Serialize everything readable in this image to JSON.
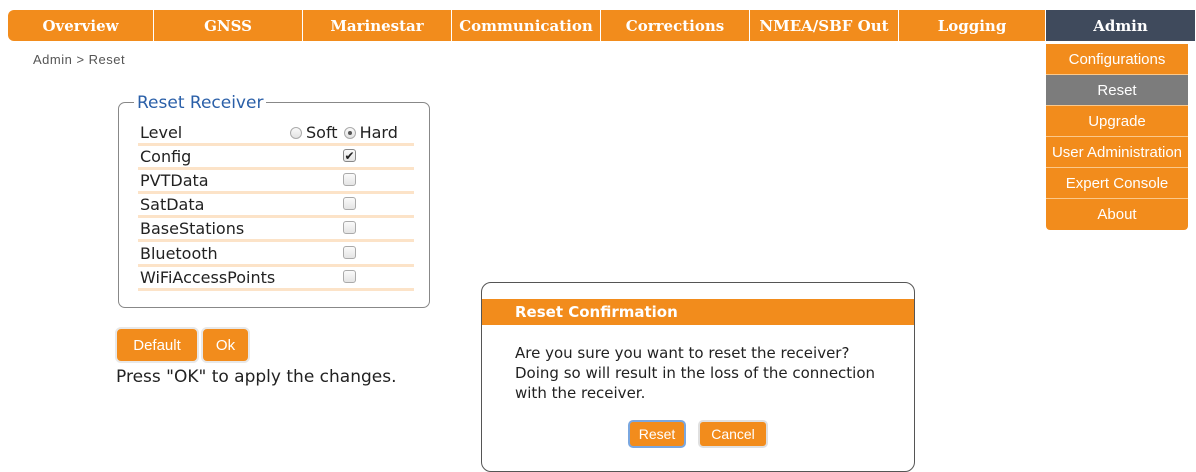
{
  "nav": {
    "tabs": [
      {
        "label": "Overview"
      },
      {
        "label": "GNSS"
      },
      {
        "label": "Marinestar"
      },
      {
        "label": "Communication"
      },
      {
        "label": "Corrections"
      },
      {
        "label": "NMEA/SBF Out"
      },
      {
        "label": "Logging"
      },
      {
        "label": "Admin",
        "active": true
      }
    ],
    "active_color": "#3f4a5c",
    "accent_color": "#f28c1c"
  },
  "breadcrumb": "Admin > Reset",
  "admin_menu": {
    "items": [
      {
        "label": "Configurations"
      },
      {
        "label": "Reset",
        "active": true
      },
      {
        "label": "Upgrade"
      },
      {
        "label": "User Administration"
      },
      {
        "label": "Expert Console"
      },
      {
        "label": "About"
      }
    ]
  },
  "reset_receiver": {
    "legend": "Reset Receiver",
    "level": {
      "label": "Level",
      "options": [
        "Soft",
        "Hard"
      ],
      "selected": "Hard"
    },
    "items": [
      {
        "label": "Config",
        "checked": true,
        "check_glyph": "✔"
      },
      {
        "label": "PVTData",
        "checked": false
      },
      {
        "label": "SatData",
        "checked": false
      },
      {
        "label": "BaseStations",
        "checked": false
      },
      {
        "label": "Bluetooth",
        "checked": false
      },
      {
        "label": "WiFiAccessPoints",
        "checked": false
      }
    ]
  },
  "buttons": {
    "default_label": "Default",
    "ok_label": "Ok"
  },
  "hint": "Press \"OK\" to apply the changes.",
  "dialog": {
    "title": "Reset Confirmation",
    "message_lines": [
      "Are you sure you want to reset the receiver?",
      "Doing so will result in the loss of the connection",
      "with the receiver."
    ],
    "reset_label": "Reset",
    "cancel_label": "Cancel"
  }
}
